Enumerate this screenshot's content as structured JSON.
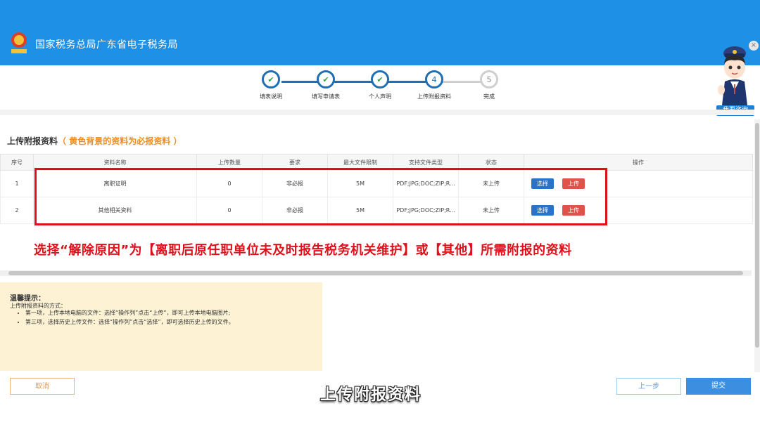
{
  "header": {
    "title": "国家税务总局广东省电子税务局",
    "logo_icon": "tax-emblem-icon"
  },
  "steps": [
    {
      "number": "1",
      "label": "填表说明",
      "state": "done"
    },
    {
      "number": "2",
      "label": "填写申请表",
      "state": "done"
    },
    {
      "number": "3",
      "label": "个人声明",
      "state": "done"
    },
    {
      "number": "4",
      "label": "上传附报资料",
      "state": "current"
    },
    {
      "number": "5",
      "label": "完成",
      "state": "todo"
    }
  ],
  "section": {
    "title": "上传附报资料",
    "note": "（ 黄色背景的资料为必报资料 ）"
  },
  "table": {
    "columns": [
      "序号",
      "资料名称",
      "上传数量",
      "要求",
      "最大文件限制",
      "支持文件类型",
      "状态",
      "操作"
    ],
    "rows": [
      {
        "index": "1",
        "name": "离职证明",
        "count": "0",
        "requirement": "非必报",
        "max_size": "5M",
        "types": "PDF;JPG;DOC;ZIP;R...",
        "status": "未上传",
        "choose": "选择",
        "upload": "上传"
      },
      {
        "index": "2",
        "name": "其他相关资料",
        "count": "0",
        "requirement": "非必报",
        "max_size": "5M",
        "types": "PDF;JPG;DOC;ZIP;R...",
        "status": "未上传",
        "choose": "选择",
        "upload": "上传"
      }
    ]
  },
  "annotation": "选择“解除原因”为【离职后原任职单位未及时报告税务机关维护】或【其他】所需附报的资料",
  "tips": {
    "title": "温馨提示：",
    "subtitle": "上传附报资料的方式：",
    "items": [
      "第一项，上传本地电脑的文件：选择“操作列”点击“上传”，即可上传本地电脑图片;",
      "第三项，选择历史上传文件：选择“操作列”点击“选择”，即可选择历史上传的文件。"
    ]
  },
  "buttons": {
    "cancel": "取消",
    "prev": "上一步",
    "submit": "提交"
  },
  "assistant": {
    "consult": "我要咨询",
    "close": "×"
  },
  "video_subtitle": "上传附报资料",
  "colors": {
    "header": "#1e90e6",
    "accent": "#1e6fb4",
    "annotation": "#e0101b",
    "tip_bg": "#fdf3d4"
  }
}
